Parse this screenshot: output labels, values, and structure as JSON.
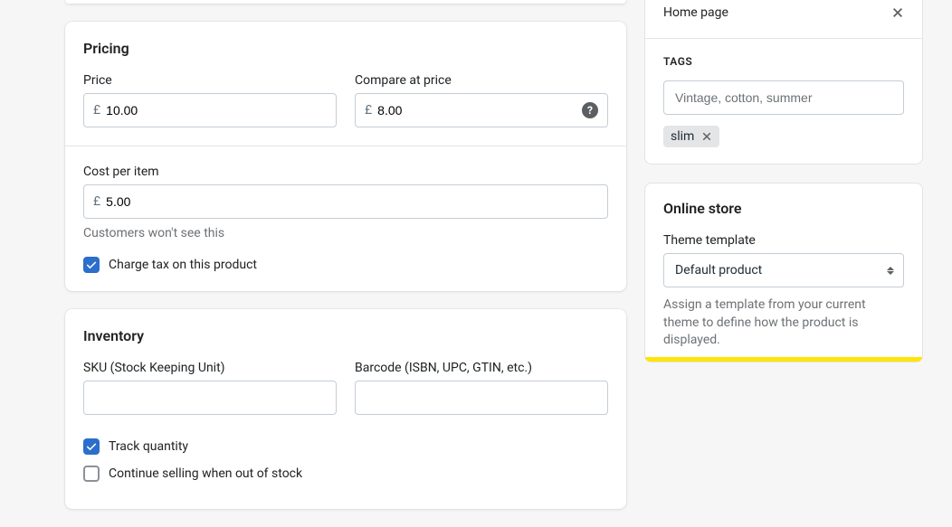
{
  "pricing": {
    "title": "Pricing",
    "price_label": "Price",
    "price_currency": "£",
    "price_value": "10.00",
    "compare_label": "Compare at price",
    "compare_currency": "£",
    "compare_value": "8.00",
    "cost_label": "Cost per item",
    "cost_currency": "£",
    "cost_value": "5.00",
    "cost_hint": "Customers won't see this",
    "tax_label": "Charge tax on this product"
  },
  "inventory": {
    "title": "Inventory",
    "sku_label": "SKU (Stock Keeping Unit)",
    "sku_value": "",
    "barcode_label": "Barcode (ISBN, UPC, GTIN, etc.)",
    "barcode_value": "",
    "track_label": "Track quantity",
    "continue_label": "Continue selling when out of stock"
  },
  "collections": {
    "home_label": "Home page"
  },
  "tags": {
    "heading": "TAGS",
    "placeholder": "Vintage, cotton, summer",
    "chip": "slim"
  },
  "online_store": {
    "title": "Online store",
    "template_label": "Theme template",
    "template_value": "Default product",
    "desc": "Assign a template from your current theme to define how the product is displayed."
  }
}
